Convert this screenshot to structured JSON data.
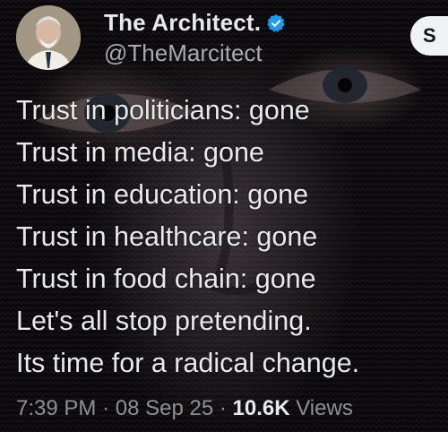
{
  "author": {
    "name": "The Architect.",
    "handle": "@TheMarcitect",
    "verified": true,
    "avatar_icon": "profile-photo-avatar"
  },
  "header": {
    "action_button_label": "S"
  },
  "tweet": {
    "lines": [
      "Trust in politicians: gone",
      "Trust in media: gone",
      "Trust in education: gone",
      "Trust in healthcare: gone",
      "Trust in food chain: gone",
      "Let's all stop pretending.",
      "Its time for a radical change."
    ]
  },
  "meta": {
    "time": "7:39 PM",
    "date": "08 Sep 25",
    "separator": "·",
    "views_count": "10.6K",
    "views_label": "Views"
  },
  "colors": {
    "background": "#000000",
    "text_primary": "#e7e9ea",
    "text_secondary": "#8b9196",
    "verified_blue": "#1d9bf0"
  }
}
